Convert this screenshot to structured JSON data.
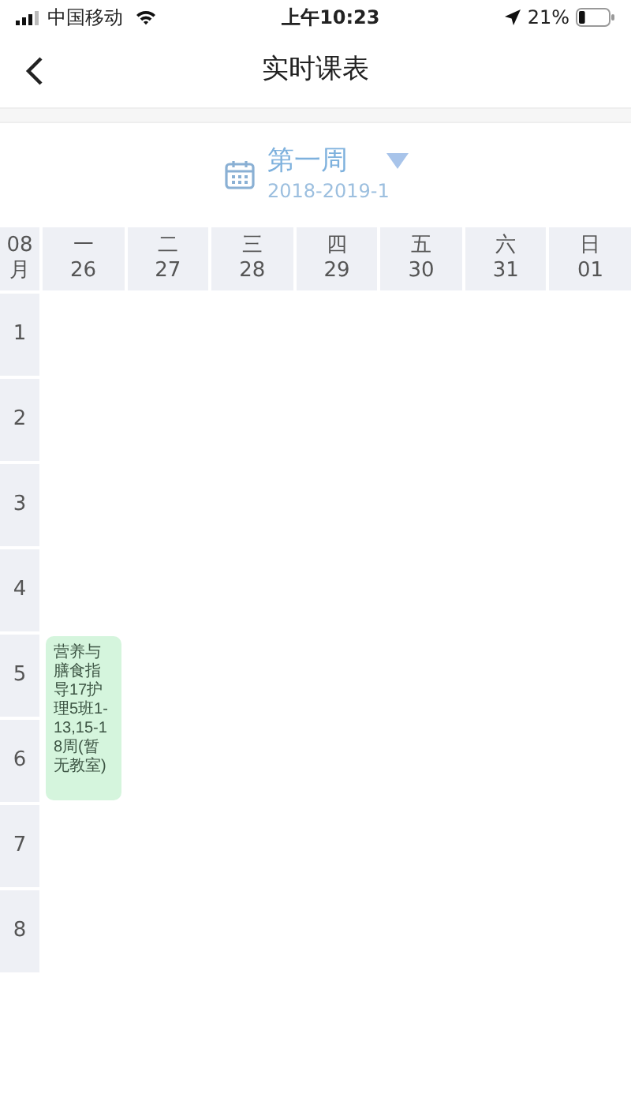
{
  "status_bar": {
    "carrier": "中国移动",
    "time": "上午10:23",
    "battery": "21%"
  },
  "nav": {
    "title": "实时课表"
  },
  "week": {
    "label": "第一周",
    "term": "2018-2019-1"
  },
  "month": {
    "number": "08",
    "unit": "月"
  },
  "days": [
    {
      "weekday": "一",
      "date": "26",
      "slots": [
        {
          "kind": "empty"
        },
        {
          "kind": "empty"
        },
        {
          "kind": "empty"
        },
        {
          "kind": "empty"
        },
        {
          "kind": "course",
          "text": "营养与膳食指导17护理5班1-13,15-18周(暂无教室)",
          "color": "#d5f5dd"
        },
        {
          "kind": "continued"
        }
      ]
    },
    {
      "weekday": "二",
      "date": "27"
    },
    {
      "weekday": "三",
      "date": "28"
    },
    {
      "weekday": "四",
      "date": "29"
    },
    {
      "weekday": "五",
      "date": "30"
    },
    {
      "weekday": "六",
      "date": "31"
    },
    {
      "weekday": "日",
      "date": "01"
    }
  ],
  "periods": [
    "1",
    "2",
    "3",
    "4",
    "5",
    "6",
    "7",
    "8"
  ]
}
